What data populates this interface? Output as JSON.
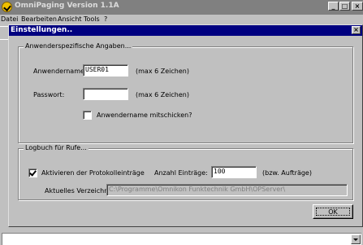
{
  "main_window": {
    "title": "OmniPaging Version 1.1A",
    "menu": [
      "Datei",
      "Bearbeiten",
      "Ansicht",
      "Tools",
      "?"
    ],
    "buttons": {
      "minimize": "_",
      "maximize": "□",
      "close": "×"
    }
  },
  "dialog": {
    "title": "Einstellungen..",
    "close": "×",
    "group_user": {
      "legend": "Anwenderspezifische Angaben...",
      "username_label": "Anwendername:",
      "username_value": "USER01",
      "username_hint": "(max 6 Zeichen)",
      "password_label": "Passwort:",
      "password_value": "",
      "password_hint": "(max 6 Zeichen)",
      "send_name_label": "Anwendername mitschicken?",
      "send_name_checked": false
    },
    "group_log": {
      "legend": "Logbuch für Rufe...",
      "activate_label": "Aktivieren der Protokolleinträge",
      "activate_checked": true,
      "count_label": "Anzahl Einträge:",
      "count_value": "100",
      "count_hint": "(bzw. Aufträge)",
      "dir_label": "Aktuelles Verzeichnis:",
      "dir_value": "C:\\Programme\\Omnikon Funktechnik GmbH\\OPServer\\"
    },
    "ok_label": "OK"
  }
}
